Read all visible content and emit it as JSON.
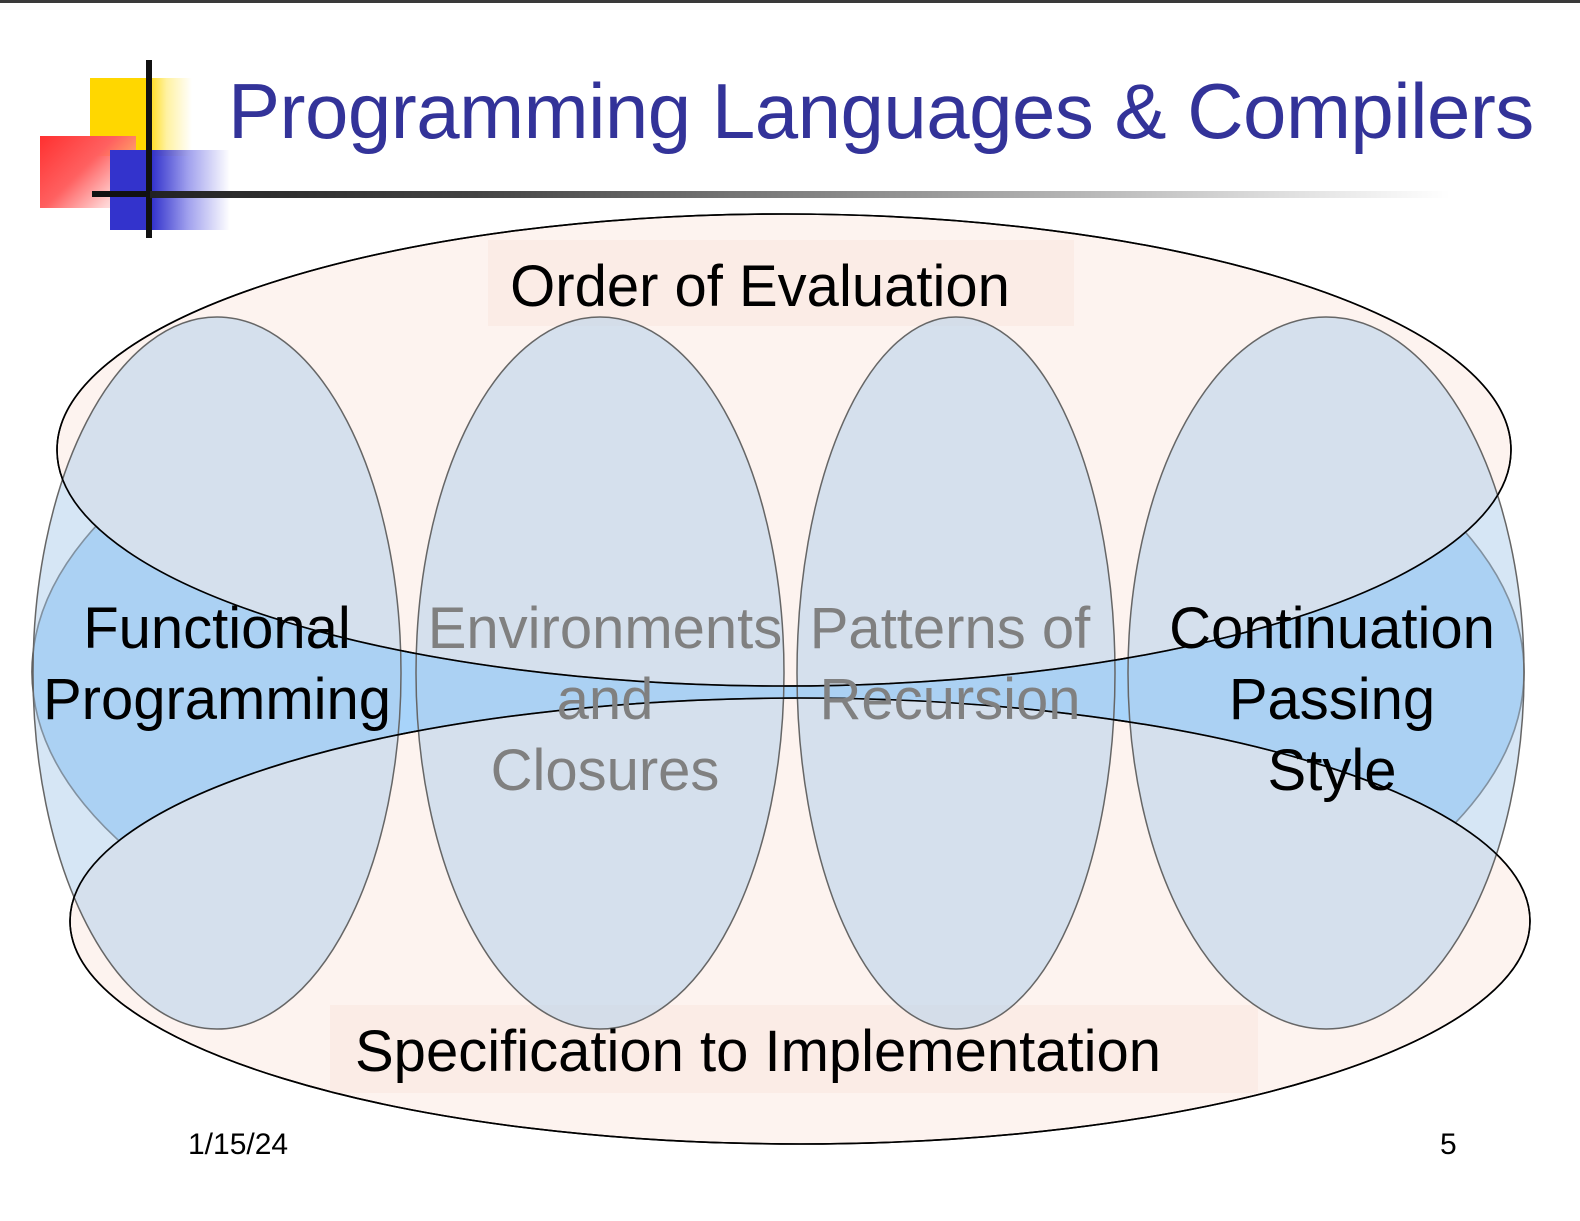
{
  "slide": {
    "title": "Programming Languages & Compilers",
    "date": "1/15/24",
    "page_number": "5"
  },
  "diagram": {
    "top_ellipse_label": "Order of Evaluation",
    "bottom_ellipse_label": "Specification to Implementation",
    "columns": [
      {
        "lines": [
          "Functional",
          "Programming"
        ]
      },
      {
        "lines": [
          "Environments",
          "and",
          "Closures"
        ]
      },
      {
        "lines": [
          "Patterns of",
          "Recursion"
        ]
      },
      {
        "lines": [
          "Continuation",
          "Passing",
          "Style"
        ]
      }
    ]
  },
  "colors": {
    "title": "#333399",
    "outer_fill": "#a8d4fa",
    "band_fill": "#fdf3ef",
    "column_fill": "#d2e3f3",
    "outline": "#555555",
    "faded_text": "#808080"
  }
}
